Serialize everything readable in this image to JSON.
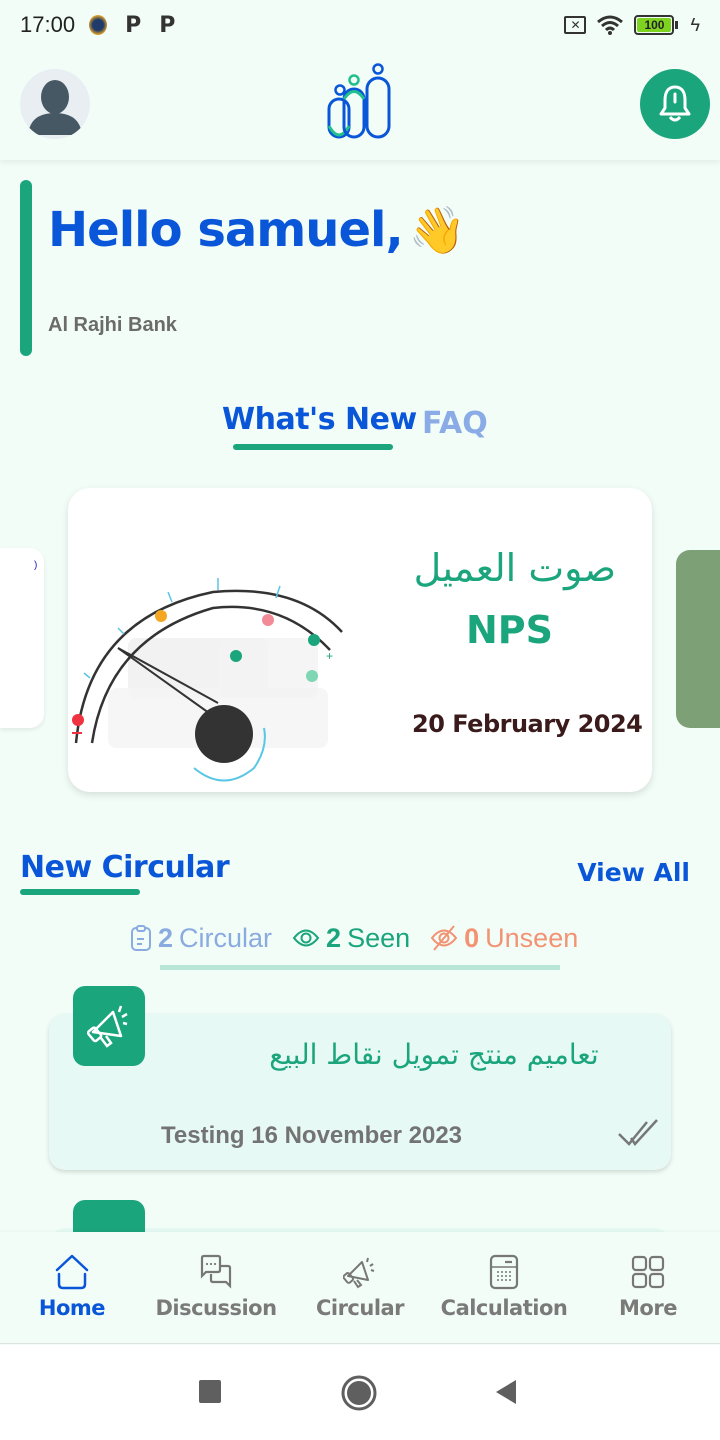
{
  "status_bar": {
    "time": "17:00",
    "notification_icons": [
      "notification-badge",
      "p-app-icon",
      "p-app-icon"
    ],
    "sim_icon": "no-sim-icon",
    "wifi_icon": "wifi-icon",
    "battery_level": "100",
    "charging_icon": "charging-bolt-icon"
  },
  "header": {
    "avatar_icon": "user-avatar-icon",
    "logo_icon": "app-logo-people-icon",
    "bell_icon": "bell-icon"
  },
  "greeting": {
    "title": "Hello samuel,",
    "emoji": "👋",
    "organization": "Al Rajhi Bank"
  },
  "news_tabs": {
    "tabs": [
      {
        "label": "What's New",
        "active": true
      },
      {
        "label": "FAQ",
        "active": false
      }
    ]
  },
  "carousel": {
    "active_banner": {
      "title_ar": "صوت العميل",
      "title_en": "NPS",
      "date": "20 February 2024"
    }
  },
  "circular_section": {
    "title": "New Circular",
    "view_all": "View All",
    "stats": {
      "total_count": "2",
      "total_label": "Circular",
      "seen_count": "2",
      "seen_label": "Seen",
      "unseen_count": "0",
      "unseen_label": "Unseen"
    },
    "items": [
      {
        "title_ar": "تعاميم منتج تمويل نقاط البيع",
        "meta": "Testing 16 November 2023",
        "status_icon": "double-check-icon"
      }
    ]
  },
  "colors": {
    "brand_green": "#1ba57c",
    "brand_blue": "#0a56d8",
    "faded_blue": "#8aabe6",
    "unseen_orange": "#f29373",
    "background": "#f3fdf8"
  },
  "bottom_nav": {
    "items": [
      {
        "label": "Home",
        "icon": "home-icon",
        "active": true
      },
      {
        "label": "Discussion",
        "icon": "chat-bubbles-icon",
        "active": false
      },
      {
        "label": "Circular",
        "icon": "megaphone-icon",
        "active": false
      },
      {
        "label": "Calculation",
        "icon": "calculator-icon",
        "active": false
      },
      {
        "label": "More",
        "icon": "grid-icon",
        "active": false
      }
    ]
  },
  "system_nav": {
    "buttons": [
      "recents-button",
      "home-button",
      "back-button"
    ]
  }
}
